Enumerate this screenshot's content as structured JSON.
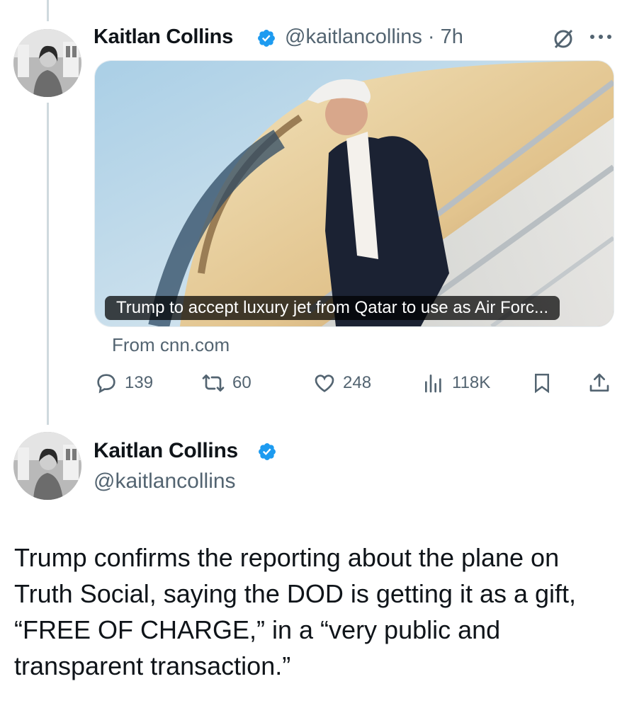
{
  "colors": {
    "text": "#0f1419",
    "secondary": "#536471",
    "verified": "#1d9bf0",
    "thread_line": "#cfd9de"
  },
  "quoted_tweet": {
    "author_name": "Kaitlan Collins",
    "handle_time": "@kaitlancollins · 7h",
    "card": {
      "image": "photo of Trump descending the steps of Air Force One",
      "caption": "Trump to accept luxury jet from Qatar to use as Air Forc...",
      "source": "From cnn.com"
    },
    "actions": {
      "replies": "139",
      "reposts": "60",
      "likes": "248",
      "views": "118K"
    },
    "icons": [
      "grok-icon",
      "more-icon",
      "reply-icon",
      "repost-icon",
      "like-icon",
      "views-icon",
      "bookmark-icon",
      "share-icon"
    ]
  },
  "main_tweet": {
    "author_name": "Kaitlan Collins",
    "handle": "@kaitlancollins",
    "text": "Trump confirms the reporting about the plane on\nTruth Social, saying the DOD is getting it as a gift,\n“FREE OF CHARGE,” in a “very public and\ntransparent transaction.”"
  }
}
